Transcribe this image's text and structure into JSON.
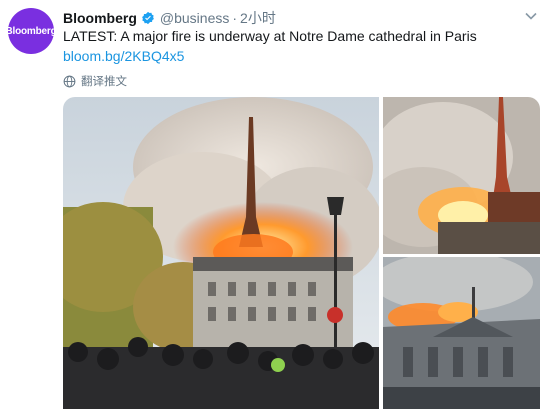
{
  "tweet": {
    "avatar_text": "Bloomberg",
    "name": "Bloomberg",
    "handle": "@business",
    "separator": "·",
    "time": "2小时",
    "text": "LATEST: A major fire is underway at Notre Dame cathedral in Paris",
    "link": "bloom.bg/2KBQ4x5",
    "translate_label": "翻译推文",
    "verified_color": "#1da1f2",
    "link_color": "#1b95e0",
    "avatar_color": "#7a2fe0"
  },
  "media": {
    "photos": [
      {
        "name": "main-photo",
        "subject": "Notre Dame spire burning with crowd watching from street"
      },
      {
        "name": "spire-closeup-photo",
        "subject": "close-up of burning spire with smoke"
      },
      {
        "name": "cathedral-roof-photo",
        "subject": "burning roof of cathedral under smoke"
      }
    ]
  }
}
